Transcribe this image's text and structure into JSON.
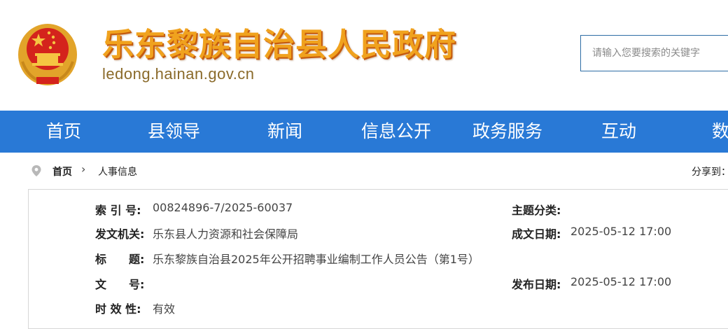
{
  "header": {
    "title": "乐东黎族自治县人民政府",
    "domain": "ledong.hainan.gov.cn",
    "emblem_icon": "national-emblem-icon",
    "search_placeholder": "请输入您要搜索的关键字"
  },
  "nav": {
    "items": [
      {
        "label": "首页"
      },
      {
        "label": "县领导"
      },
      {
        "label": "新闻"
      },
      {
        "label": "信息公开"
      },
      {
        "label": "政务服务"
      },
      {
        "label": "互动"
      },
      {
        "label": "数"
      }
    ]
  },
  "breadcrumb": {
    "icon": "location-pin-icon",
    "home": "首页",
    "separator": "›",
    "current": "人事信息",
    "share_label": "分享到："
  },
  "info": {
    "index_label": "索 引 号:",
    "index_value": "00824896-7/2025-60037",
    "topic_label": "主题分类:",
    "topic_value": "",
    "issuer_label": "发文机关:",
    "issuer_value": "乐东县人力资源和社会保障局",
    "written_label": "成文日期:",
    "written_value": "2025-05-12 17:00",
    "title_label": "标　　题:",
    "title_value": "乐东黎族自治县2025年公开招聘事业编制工作人员公告（第1号）",
    "docno_label": "文　　号:",
    "docno_value": "",
    "published_label": "发布日期:",
    "published_value": "2025-05-12 17:00",
    "validity_label": "时 效 性:",
    "validity_value": "有效"
  },
  "colors": {
    "nav_bg": "#2979d6",
    "title_gold": "#f0a21e",
    "search_border": "#2e6da4"
  }
}
